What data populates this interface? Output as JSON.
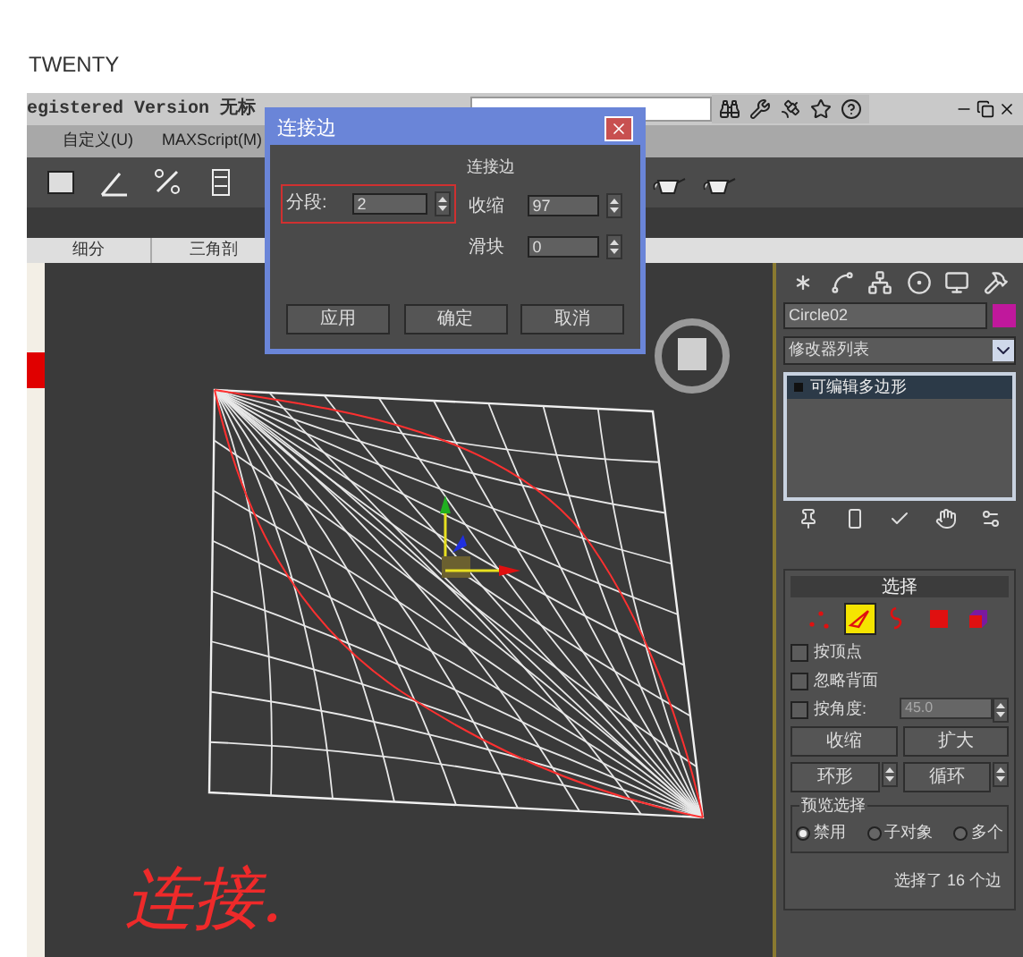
{
  "page_heading": "TWENTY",
  "app": {
    "title": "egistered Version  无标",
    "menus": [
      "自定义(U)",
      "MAXScript(M)"
    ],
    "ribbon_tabs": [
      "细分",
      "三角剖"
    ]
  },
  "dialog": {
    "title": "连接边",
    "group": "连接边",
    "fields": [
      {
        "label": "分段:",
        "value": "2",
        "highlighted": true
      },
      {
        "label": "收缩",
        "value": "97",
        "highlighted": false
      },
      {
        "label": "滑块",
        "value": "0",
        "highlighted": false
      }
    ],
    "buttons": [
      "应用",
      "确定",
      "取消"
    ]
  },
  "command_panel": {
    "object": {
      "name": "Circle02",
      "color": "#c0189c"
    },
    "modifier_list": "修改器列表",
    "stack": [
      {
        "label": "可编辑多边形",
        "selected": true
      }
    ],
    "selection": {
      "title": "选择",
      "levels": [
        {
          "kind": "vertex",
          "selected": false
        },
        {
          "kind": "edge",
          "selected": true
        },
        {
          "kind": "border",
          "selected": false
        },
        {
          "kind": "polygon",
          "selected": false
        },
        {
          "kind": "element",
          "selected": false
        }
      ],
      "checkboxes": [
        {
          "label": "按顶点",
          "checked": false
        },
        {
          "label": "忽略背面",
          "checked": false
        },
        {
          "label": "按角度:",
          "checked": false,
          "value": "45.0",
          "disabled": true
        }
      ],
      "buttons": [
        "收缩",
        "扩大"
      ],
      "spinner_buttons": [
        "环形",
        "循环"
      ],
      "preview": {
        "title": "预览选择",
        "options": [
          {
            "label": "禁用",
            "selected": true
          },
          {
            "label": "子对象",
            "selected": false
          },
          {
            "label": "多个",
            "selected": false
          }
        ]
      },
      "status": "选择了 16 个边"
    }
  },
  "annotation": "连接."
}
